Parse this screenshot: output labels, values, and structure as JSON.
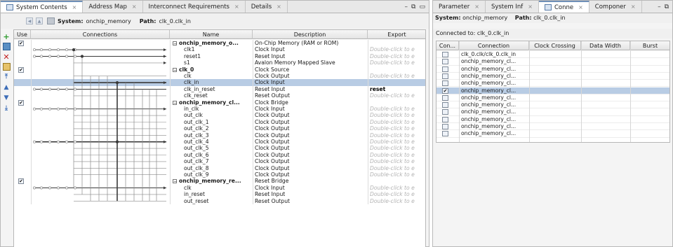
{
  "left_tabs": [
    {
      "label": "System Contents",
      "active": true
    },
    {
      "label": "Address Map",
      "active": false
    },
    {
      "label": "Interconnect Requirements",
      "active": false
    },
    {
      "label": "Details",
      "active": false
    }
  ],
  "right_tabs": [
    {
      "label": "Parameter",
      "active": false
    },
    {
      "label": "System Inf",
      "active": false
    },
    {
      "label": "Conne",
      "active": true
    },
    {
      "label": "Componer",
      "active": false
    }
  ],
  "tab_close_glyph": "⨯",
  "win_controls": {
    "minimize": "–",
    "restore": "⧉"
  },
  "toolbar": {
    "system_label": "System:",
    "system_value": "onchip_memory",
    "path_label": "Path:",
    "path_value": "clk_0.clk_in"
  },
  "left_table": {
    "headers": [
      "Use",
      "Connections",
      "Name",
      "Description",
      "Export"
    ],
    "rows": [
      {
        "name": "onchip_memory_o...",
        "desc": "On-Chip Memory (RAM or ROM)",
        "export": "",
        "group": true,
        "use": true
      },
      {
        "name": "clk1",
        "desc": "Clock Input",
        "export": "Double-click to e"
      },
      {
        "name": "reset1",
        "desc": "Reset Input",
        "export": "Double-click to e"
      },
      {
        "name": "s1",
        "desc": "Avalon Memory Mapped Slave",
        "export": "Double-click to e"
      },
      {
        "name": "clk_0",
        "desc": "Clock Source",
        "export": "",
        "group": true,
        "use": true
      },
      {
        "name": "clk",
        "desc": "Clock Output",
        "export": "Double-click to e"
      },
      {
        "name": "clk_in",
        "desc": "Clock Input",
        "export": "",
        "selected": true
      },
      {
        "name": "clk_in_reset",
        "desc": "Reset Input",
        "export": "reset",
        "export_value": true
      },
      {
        "name": "clk_reset",
        "desc": "Reset Output",
        "export": "Double-click to e"
      },
      {
        "name": "onchip_memory_cl...",
        "desc": "Clock Bridge",
        "export": "",
        "group": true,
        "use": true
      },
      {
        "name": "in_clk",
        "desc": "Clock Input",
        "export": "Double-click to e"
      },
      {
        "name": "out_clk",
        "desc": "Clock Output",
        "export": "Double-click to e"
      },
      {
        "name": "out_clk_1",
        "desc": "Clock Output",
        "export": "Double-click to e"
      },
      {
        "name": "out_clk_2",
        "desc": "Clock Output",
        "export": "Double-click to e"
      },
      {
        "name": "out_clk_3",
        "desc": "Clock Output",
        "export": "Double-click to e"
      },
      {
        "name": "out_clk_4",
        "desc": "Clock Output",
        "export": "Double-click to e"
      },
      {
        "name": "out_clk_5",
        "desc": "Clock Output",
        "export": "Double-click to e"
      },
      {
        "name": "out_clk_6",
        "desc": "Clock Output",
        "export": "Double-click to e"
      },
      {
        "name": "out_clk_7",
        "desc": "Clock Output",
        "export": "Double-click to e"
      },
      {
        "name": "out_clk_8",
        "desc": "Clock Output",
        "export": "Double-click to e"
      },
      {
        "name": "out_clk_9",
        "desc": "Clock Output",
        "export": "Double-click to e"
      },
      {
        "name": "onchip_memory_re...",
        "desc": "Reset Bridge",
        "export": "",
        "group": true,
        "use": true
      },
      {
        "name": "clk",
        "desc": "Clock Input",
        "export": "Double-click to e"
      },
      {
        "name": "in_reset",
        "desc": "Reset Input",
        "export": "Double-click to e"
      },
      {
        "name": "out_reset",
        "desc": "Reset Output",
        "export": "Double-click to e"
      }
    ]
  },
  "right_panel": {
    "system_label": "System:",
    "system_value": "onchip_memory",
    "path_label": "Path:",
    "path_value": "clk_0.clk_in",
    "connected_label": "Connected to:",
    "connected_value": "clk_0.clk_in",
    "headers": [
      "Con...",
      "Connection",
      "Clock Crossing",
      "Data Width",
      "Burst"
    ],
    "rows": [
      {
        "connection": "clk_0.clk/clk_0.clk_in",
        "checked": false,
        "selected": false
      },
      {
        "connection": "onchip_memory_cl...",
        "checked": false,
        "selected": false
      },
      {
        "connection": "onchip_memory_cl...",
        "checked": false,
        "selected": false
      },
      {
        "connection": "onchip_memory_cl...",
        "checked": false,
        "selected": false
      },
      {
        "connection": "onchip_memory_cl...",
        "checked": false,
        "selected": false
      },
      {
        "connection": "onchip_memory_cl...",
        "checked": true,
        "selected": true
      },
      {
        "connection": "onchip_memory_cl...",
        "checked": false,
        "selected": false
      },
      {
        "connection": "onchip_memory_cl...",
        "checked": false,
        "selected": false
      },
      {
        "connection": "onchip_memory_cl...",
        "checked": false,
        "selected": false
      },
      {
        "connection": "onchip_memory_cl...",
        "checked": false,
        "selected": false
      },
      {
        "connection": "onchip_memory_cl...",
        "checked": false,
        "selected": false
      },
      {
        "connection": "onchip_memory_cl...",
        "checked": false,
        "selected": false
      }
    ]
  },
  "colors": {
    "selection": "#b8cce4",
    "wire": "#3a3a3a",
    "wire_faint": "#8a8a8a"
  }
}
